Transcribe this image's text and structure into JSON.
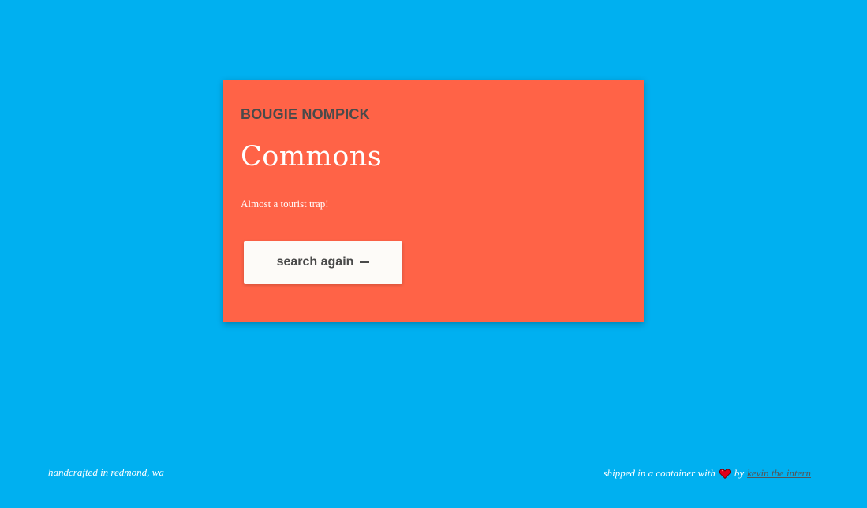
{
  "card": {
    "eyebrow": "BOUGIE NOMPICK",
    "title": "Commons",
    "tagline": "Almost a tourist trap!",
    "button_label": "search again"
  },
  "footer": {
    "left_text": "handcrafted in redmond, wa",
    "right_prefix": "shipped in a container with",
    "right_by": "by",
    "author_link": "kevin the intern"
  },
  "colors": {
    "background": "#00b0f0",
    "card": "#ff6347",
    "button": "#fdfbf8",
    "heart": "#e0001b"
  },
  "icons": {
    "button_icon": "dash-icon",
    "footer_icon": "heart-icon"
  }
}
